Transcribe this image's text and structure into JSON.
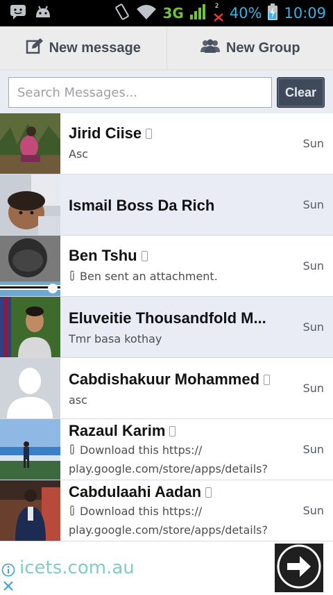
{
  "status_bar": {
    "network": "3G",
    "notification_count": "2",
    "battery": "40%",
    "time": "10:09",
    "accent_color": "#33b5e5"
  },
  "actions": {
    "new_message": "New message",
    "new_group": "New Group"
  },
  "search": {
    "placeholder": "Search Messages...",
    "clear_label": "Clear"
  },
  "conversations": [
    {
      "name": "Jirid Ciise",
      "preview_line1": "Asc",
      "preview_line2": "",
      "time": "Sun",
      "phone_icon": true,
      "attachment": false
    },
    {
      "name": "Ismail Boss Da Rich",
      "preview_line1": "",
      "preview_line2": "",
      "time": "Sun",
      "phone_icon": false,
      "attachment": false
    },
    {
      "name": "Ben Tshu",
      "preview_line1": "Ben sent an attachment.",
      "preview_line2": "",
      "time": "Sun",
      "phone_icon": true,
      "attachment": true
    },
    {
      "name": "Eluveitie Thousandfold M...",
      "preview_line1": "Tmr basa kothay",
      "preview_line2": "",
      "time": "Sun",
      "phone_icon": false,
      "attachment": false
    },
    {
      "name": "Cabdishakuur Mohammed",
      "preview_line1": "asc",
      "preview_line2": "",
      "time": "Sun",
      "phone_icon": true,
      "attachment": false
    },
    {
      "name": "Razaul Karim",
      "preview_line1": "Download this https://",
      "preview_line2": "play.google.com/store/apps/details?",
      "time": "Sun",
      "phone_icon": true,
      "attachment": true
    },
    {
      "name": "Cabdulaahi Aadan",
      "preview_line1": "Download this https://",
      "preview_line2": "play.google.com/store/apps/details?",
      "time": "Sun",
      "phone_icon": true,
      "attachment": true
    }
  ],
  "ad": {
    "text": "icets.com.au"
  }
}
